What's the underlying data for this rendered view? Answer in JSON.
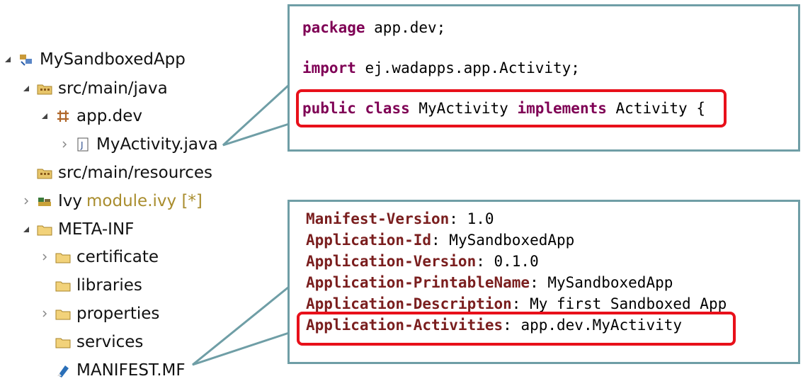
{
  "tree": {
    "items": [
      {
        "label": "MySandboxedApp",
        "icon": "project-icon",
        "twisty": "expanded"
      },
      {
        "label": "src/main/java",
        "icon": "source-folder-icon",
        "twisty": "expanded"
      },
      {
        "label": "app.dev",
        "icon": "package-icon",
        "twisty": "expanded"
      },
      {
        "label": "MyActivity.java",
        "icon": "java-file-icon",
        "twisty": "collapsed"
      },
      {
        "label": "src/main/resources",
        "icon": "source-folder-icon",
        "twisty": "none"
      },
      {
        "label": "Ivy",
        "extra": "module.ivy [*]",
        "icon": "ivy-icon",
        "twisty": "collapsed"
      },
      {
        "label": "META-INF",
        "icon": "folder-icon",
        "twisty": "expanded"
      },
      {
        "label": "certificate",
        "icon": "folder-icon",
        "twisty": "collapsed"
      },
      {
        "label": "libraries",
        "icon": "folder-icon",
        "twisty": "none"
      },
      {
        "label": "properties",
        "icon": "folder-icon",
        "twisty": "collapsed"
      },
      {
        "label": "services",
        "icon": "folder-icon",
        "twisty": "none"
      },
      {
        "label": "MANIFEST.MF",
        "icon": "manifest-file-icon",
        "twisty": "none"
      }
    ]
  },
  "java_code": {
    "line1": {
      "kw": "package",
      "rest": " app.dev;"
    },
    "line2": {
      "kw": "import",
      "rest": " ej.wadapps.app.Activity;"
    },
    "line3": {
      "kw1": "public",
      "kw2": "class",
      "name": " MyActivity ",
      "kw3": "implements",
      "rest": " Activity",
      "brace": " {"
    }
  },
  "manifest": {
    "lines": [
      {
        "key": "Manifest-Version",
        "value": ": 1.0"
      },
      {
        "key": "Application-Id",
        "value": ": MySandboxedApp"
      },
      {
        "key": "Application-Version",
        "value": ": 0.1.0"
      },
      {
        "key": "Application-PrintableName",
        "value": ": MySandboxedApp"
      },
      {
        "key": "Application-Description",
        "value": ": My first Sandboxed App"
      },
      {
        "key": "Application-Activities",
        "value": ": app.dev.MyActivity"
      }
    ]
  },
  "colors": {
    "keyword": "#7f0055",
    "manifest_key": "#7a1e1e",
    "highlight": "#e8101a",
    "callout_border": "#6f9ea6"
  }
}
